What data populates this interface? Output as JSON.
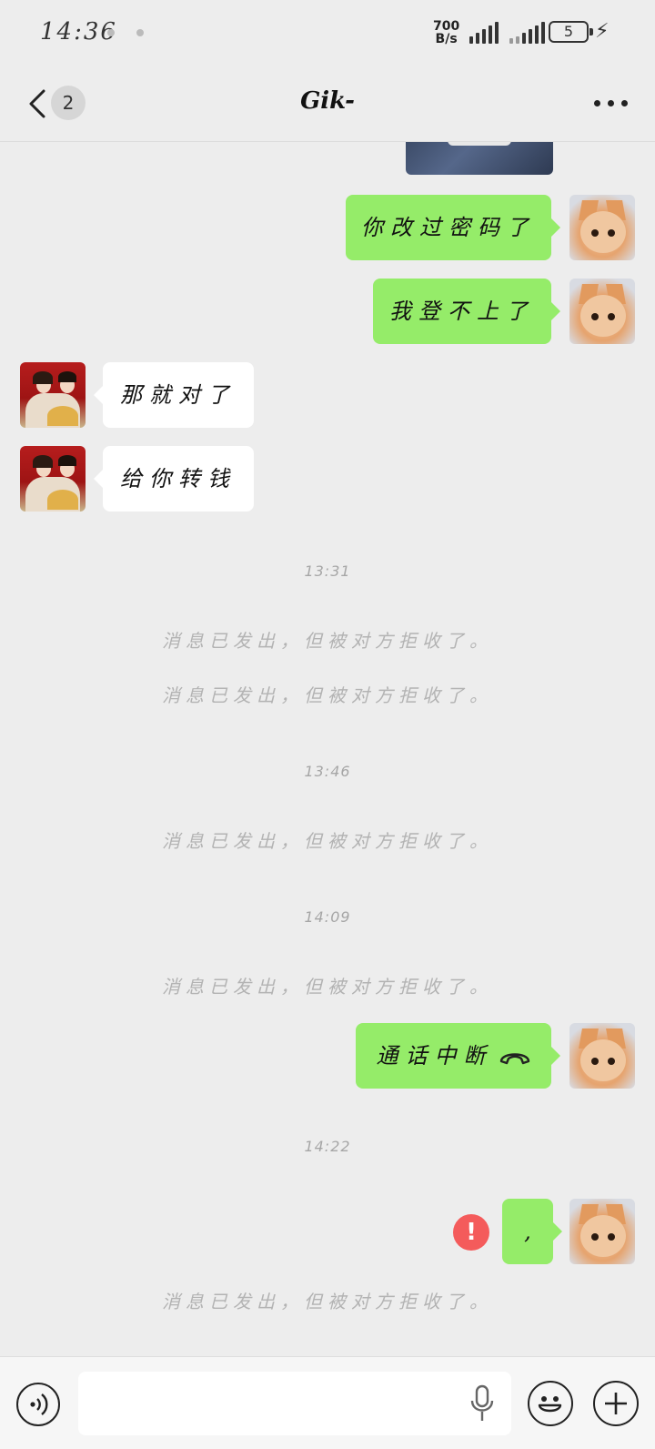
{
  "status_bar": {
    "time": "14:36",
    "net_speed_value": "700",
    "net_speed_unit": "B/s",
    "battery_level": "5"
  },
  "header": {
    "unread_count": "2",
    "contact_name": "Gik-"
  },
  "messages": {
    "m1": "你改过密码了",
    "m2": "我登不上了",
    "m3": "那就对了",
    "m4": "给你转钱",
    "m5": "通话中断",
    "m6": ","
  },
  "timestamps": {
    "t1": "13:31",
    "t2": "13:46",
    "t3": "14:09",
    "t4": "14:22"
  },
  "system": {
    "rejected": "消息已发出，但被对方拒收了。"
  },
  "input": {
    "placeholder": ""
  },
  "colors": {
    "my_bubble": "#95ec69",
    "their_bubble": "#ffffff",
    "background": "#ededed",
    "error": "#f45b5b"
  }
}
